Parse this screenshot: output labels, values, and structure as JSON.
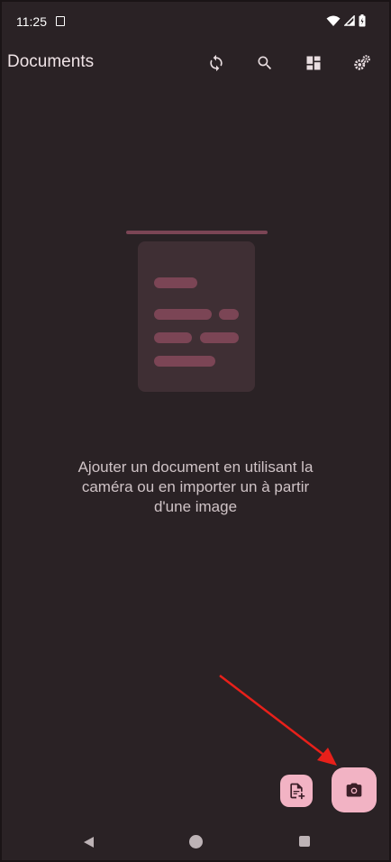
{
  "status_bar": {
    "time": "11:25",
    "icons": [
      "note-icon",
      "wifi-icon",
      "signal-icon",
      "battery-icon"
    ]
  },
  "app_bar": {
    "title": "Documents",
    "actions": [
      {
        "name": "sync-icon",
        "label": "sync"
      },
      {
        "name": "search-icon",
        "label": "search"
      },
      {
        "name": "layout-icon",
        "label": "layout"
      },
      {
        "name": "settings-icon",
        "label": "settings"
      }
    ]
  },
  "empty_state": {
    "message": "Ajouter un document en utilisant la\ncaméra ou en importer un à partir\nd'une image"
  },
  "fabs": {
    "import": "document-add-icon",
    "camera": "camera-icon"
  },
  "colors": {
    "background": "#2a2225",
    "accent": "#f2b3c4",
    "illustration_card": "#3f2f34",
    "illustration_line": "#7b4555",
    "annotation": "#e8201a"
  },
  "nav_bar": {
    "buttons": [
      "back-icon",
      "home-icon",
      "recents-icon"
    ]
  }
}
